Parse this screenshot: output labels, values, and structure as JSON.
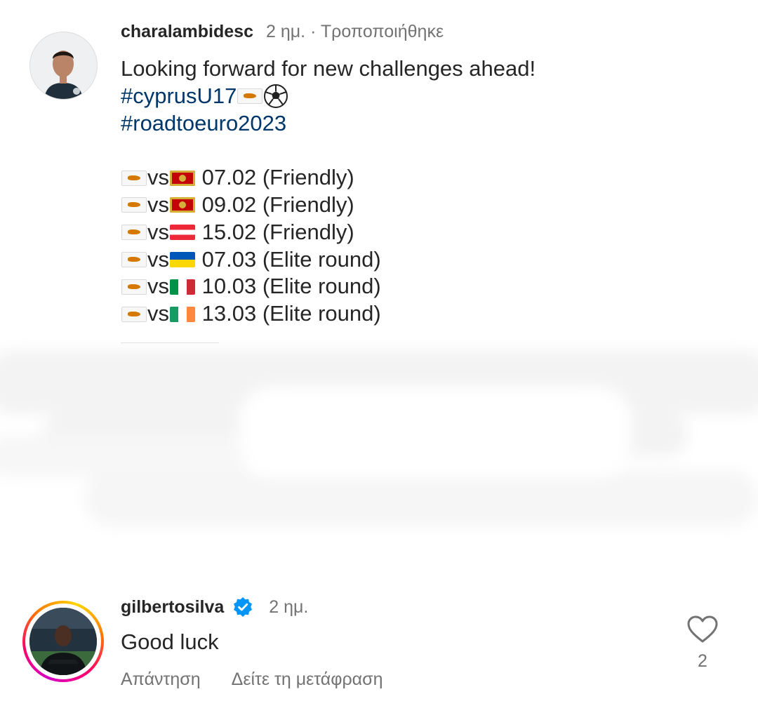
{
  "caption": {
    "username": "charalambidesc",
    "time": "2 ημ.",
    "separator": "·",
    "edited": "Τροποποιήθηκε",
    "intro": "Looking forward for new challenges ahead!",
    "hashtag1": "#cyprusU17",
    "hashtag2": "#roadtoeuro2023",
    "matches": [
      {
        "vs": "vs",
        "opponent_flag": "montenegro-flag-icon",
        "date": "07.02",
        "type": "(Friendly)"
      },
      {
        "vs": "vs",
        "opponent_flag": "montenegro-flag-icon",
        "date": "09.02",
        "type": "(Friendly)"
      },
      {
        "vs": "vs",
        "opponent_flag": "austria-flag-icon",
        "date": "15.02",
        "type": "(Friendly)"
      },
      {
        "vs": "vs",
        "opponent_flag": "ukraine-flag-icon",
        "date": "07.03",
        "type": "(Elite round)"
      },
      {
        "vs": "vs",
        "opponent_flag": "italy-flag-icon",
        "date": "10.03",
        "type": "(Elite round)"
      },
      {
        "vs": "vs",
        "opponent_flag": "ireland-flag-icon",
        "date": "13.03",
        "type": "(Elite round)"
      }
    ]
  },
  "comment": {
    "username": "gilbertosilva",
    "verified": true,
    "time": "2 ημ.",
    "text": "Good luck",
    "reply_label": "Απάντηση",
    "translate_label": "Δείτε τη μετάφραση",
    "likes": "2"
  },
  "colors": {
    "text": "#262626",
    "secondary": "#737373",
    "hashtag": "#00376b",
    "verified": "#0095f6"
  },
  "icons": {
    "home_flag": "cyprus-flag-icon",
    "ball": "soccer-ball-icon",
    "like": "heart-icon",
    "verified": "verified-badge-icon"
  }
}
